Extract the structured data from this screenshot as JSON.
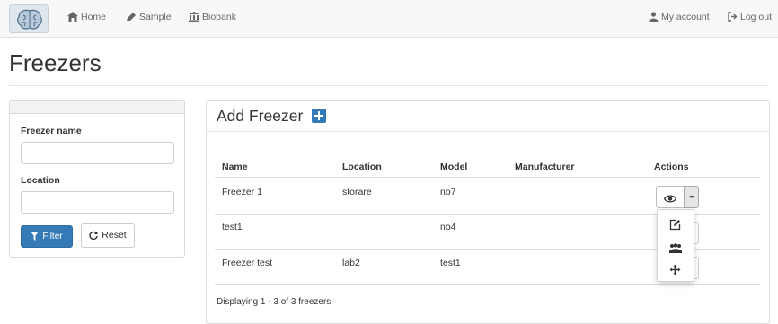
{
  "nav": {
    "home": "Home",
    "sample": "Sample",
    "biobank": "Biobank",
    "account": "My account",
    "logout": "Log out"
  },
  "page": {
    "title": "Freezers"
  },
  "filter": {
    "name_label": "Freezer name",
    "name_value": "",
    "location_label": "Location",
    "location_value": "",
    "filter_button": "Filter",
    "reset_button": "Reset"
  },
  "panel": {
    "title": "Add Freezer",
    "columns": [
      "Name",
      "Location",
      "Model",
      "Manufacturer",
      "Actions"
    ],
    "rows": [
      {
        "name": "Freezer 1",
        "location": "storare",
        "model": "no7",
        "manufacturer": ""
      },
      {
        "name": "test1",
        "location": "",
        "model": "no4",
        "manufacturer": ""
      },
      {
        "name": "Freezer test",
        "location": "lab2",
        "model": "test1",
        "manufacturer": ""
      }
    ],
    "footer": "Displaying 1 - 3 of 3 freezers"
  },
  "icons": {
    "logo": "brain-logo-icon",
    "home": "home-icon",
    "sample": "pipette-icon",
    "biobank": "bank-icon",
    "account": "user-icon",
    "logout": "sign-out-icon",
    "filter": "funnel-icon",
    "reset": "refresh-icon",
    "add": "plus-square-icon",
    "view": "eye-icon",
    "edit": "edit-icon",
    "group": "group-icon",
    "move": "move-icon"
  },
  "colors": {
    "primary": "#337ab7",
    "navbar_bg": "#f8f8f8",
    "text": "#333333"
  }
}
